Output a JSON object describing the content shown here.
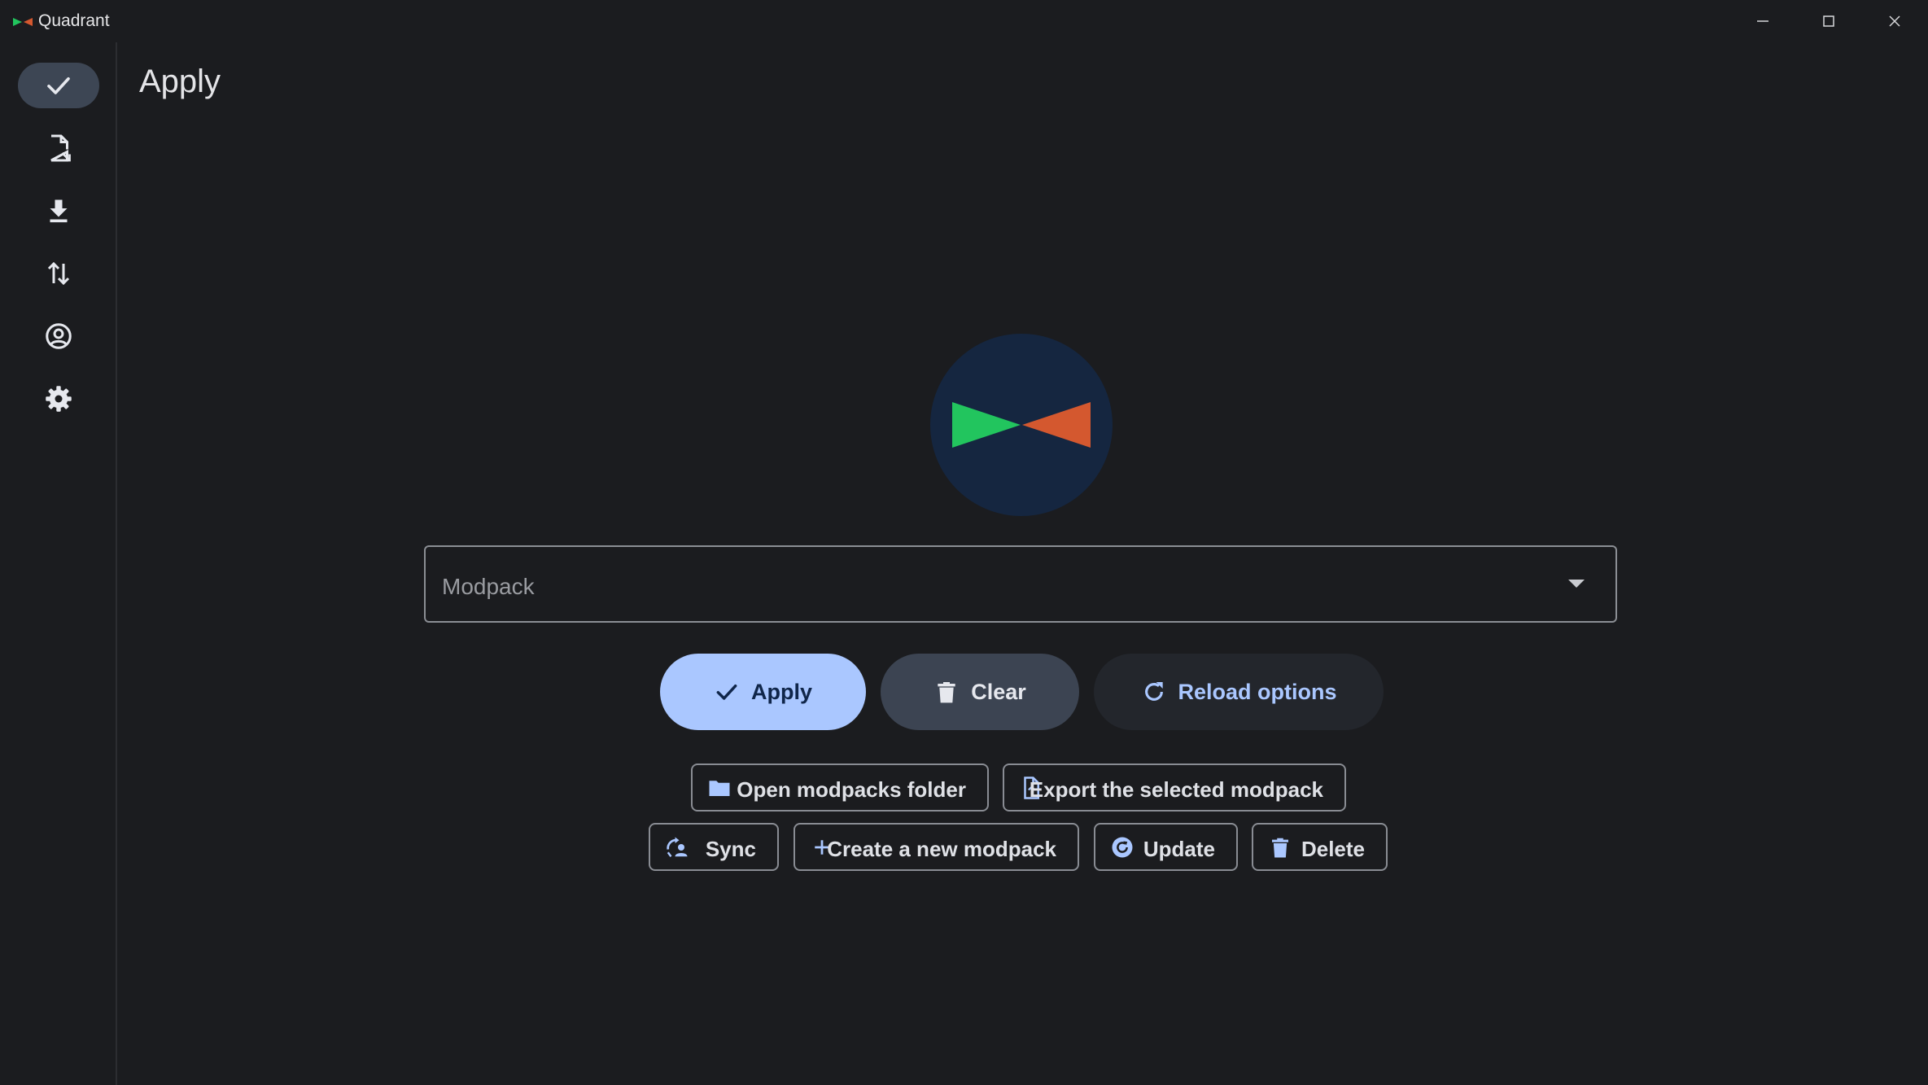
{
  "window": {
    "title": "Quadrant",
    "controls": [
      "minimize-icon",
      "maximize-icon",
      "close-icon"
    ]
  },
  "nav": {
    "items": [
      {
        "icon": "check-icon",
        "active": true
      },
      {
        "icon": "file-export-icon",
        "active": false
      },
      {
        "icon": "download-icon",
        "active": false
      },
      {
        "icon": "swap-vertical-icon",
        "active": false
      },
      {
        "icon": "account-circle-icon",
        "active": false
      },
      {
        "icon": "gear-icon",
        "active": false
      }
    ]
  },
  "page": {
    "title": "Apply",
    "logo": "quadrant-logo"
  },
  "modpack_select": {
    "label": "Modpack",
    "value": ""
  },
  "actions": {
    "apply": "Apply",
    "clear": "Clear",
    "reload": "Reload options"
  },
  "tools": {
    "open_folder": "Open modpacks folder",
    "export": "Export the selected modpack",
    "sync": "Sync",
    "create": "Create a new modpack",
    "update": "Update",
    "delete": "Delete"
  },
  "colors": {
    "accent": "#aac7ff",
    "logo_green": "#22c55e",
    "logo_orange": "#d4582f",
    "logo_bg": "#152640"
  }
}
